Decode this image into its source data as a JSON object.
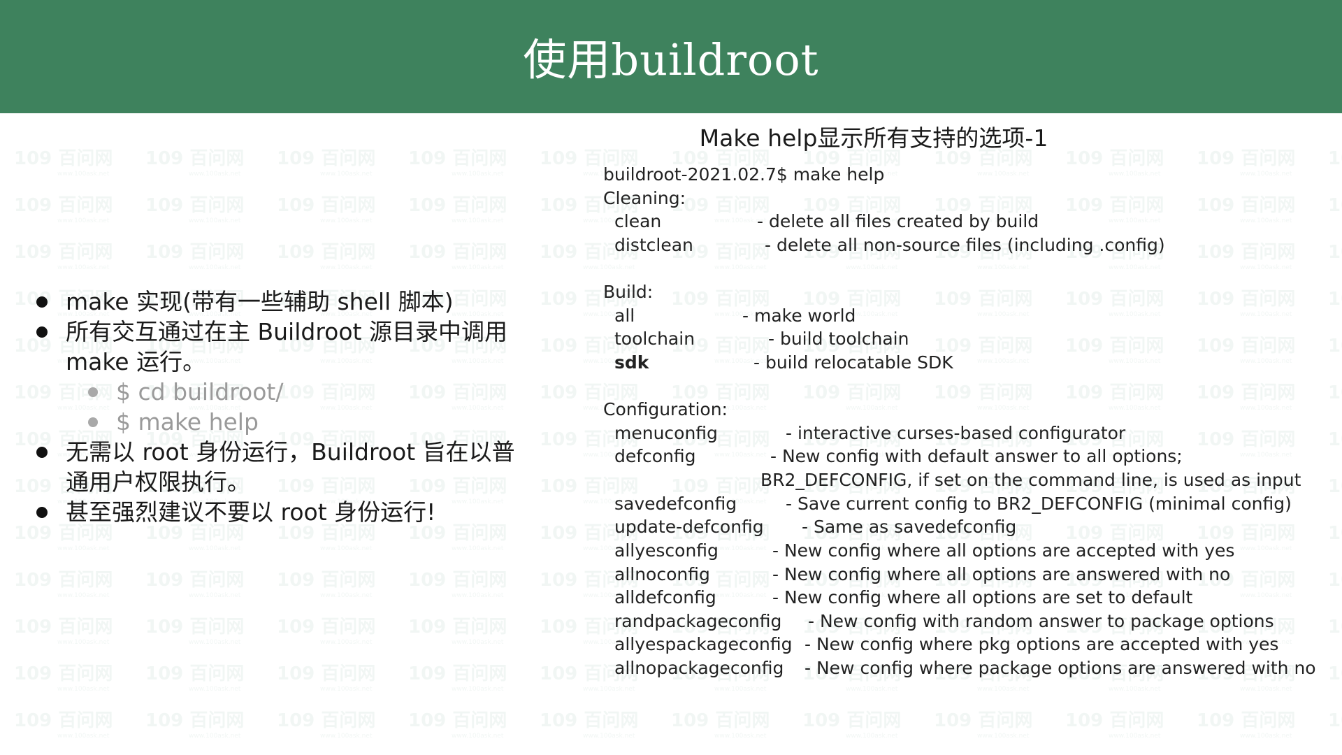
{
  "colors": {
    "header_bg": "#3e825d"
  },
  "slide": {
    "title": "使用buildroot"
  },
  "watermark": {
    "text": "109 百问网",
    "subtext": "www.100ask.net"
  },
  "left": {
    "bullets": [
      "make 实现(带有一些辅助 shell 脚本)",
      "所有交互通过在主 Buildroot 源目录中调用",
      "make 运行。",
      "$ cd buildroot/",
      "$ make help",
      "无需以 root 身份运行，Buildroot 旨在以普",
      "通用户权限执行。",
      "甚至强烈建议不要以 root 身份运行!"
    ]
  },
  "right": {
    "title": "Make help显示所有支持的选项-1",
    "prompt": "buildroot-2021.02.7$ make help",
    "cleaning": {
      "heading": "Cleaning:",
      "items": [
        {
          "option": "clean",
          "desc": "- delete all files created by build"
        },
        {
          "option": "distclean",
          "desc": "- delete all non-source files (including .config)"
        }
      ]
    },
    "build": {
      "heading": "Build:",
      "items": [
        {
          "option": "all",
          "desc": "- make world"
        },
        {
          "option": "toolchain",
          "desc": "- build toolchain"
        },
        {
          "option": "sdk",
          "desc": "- build relocatable SDK"
        }
      ]
    },
    "configuration": {
      "heading": "Configuration:",
      "items": [
        {
          "option": "menuconfig",
          "desc": "- interactive curses-based configurator"
        },
        {
          "option": "defconfig",
          "desc": "- New config with default answer to all options;"
        },
        {
          "option": "",
          "desc": "BR2_DEFCONFIG, if set on the command line, is used as input"
        },
        {
          "option": "savedefconfig",
          "desc": "- Save current config to BR2_DEFCONFIG (minimal config)"
        },
        {
          "option": "update-defconfig",
          "desc": "- Same as savedefconfig"
        },
        {
          "option": "allyesconfig",
          "desc": "- New config where all options are accepted with yes"
        },
        {
          "option": "allnoconfig",
          "desc": "- New config where all options are answered with no"
        },
        {
          "option": "alldefconfig",
          "desc": "- New config where all options are set to default"
        },
        {
          "option": "randpackageconfig",
          "desc": "- New config with random answer to package options"
        },
        {
          "option": "allyespackageconfig",
          "desc": "- New config where pkg options are accepted with yes"
        },
        {
          "option": "allnopackageconfig",
          "desc": "- New config where package options are answered with no"
        }
      ]
    }
  }
}
